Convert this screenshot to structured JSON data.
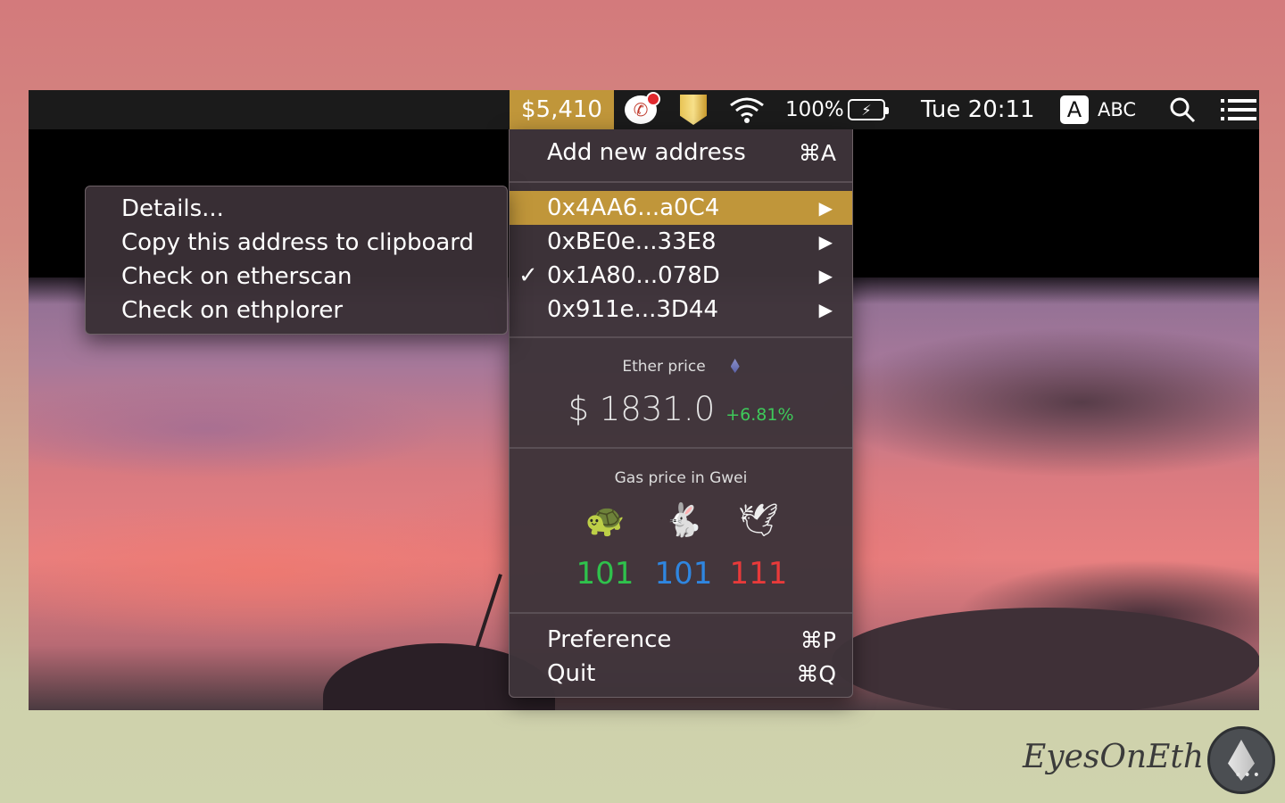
{
  "menubar": {
    "portfolio_value": "$5,410",
    "battery_percent": "100%",
    "clock": "Tue 20:11",
    "input_source_letter": "A",
    "input_source_label": "ABC",
    "icons": [
      "phone-icon",
      "shield-icon",
      "wifi-icon",
      "battery-charging-icon",
      "search-icon",
      "list-icon"
    ]
  },
  "menu": {
    "add_address": {
      "label": "Add new address",
      "shortcut": "⌘A"
    },
    "addresses": [
      {
        "label": "0x4AA6...a0C4",
        "highlighted": true,
        "checked": false,
        "arrow": "▶"
      },
      {
        "label": "0xBE0e...33E8",
        "highlighted": false,
        "checked": false,
        "arrow": "▶"
      },
      {
        "label": "0x1A80...078D",
        "highlighted": false,
        "checked": true,
        "arrow": "▶"
      },
      {
        "label": "0x911e...3D44",
        "highlighted": false,
        "checked": false,
        "arrow": "▶"
      }
    ],
    "check_mark": "✓",
    "ether": {
      "title": "Ether price",
      "value": "$ 1831.0",
      "change": "+6.81%"
    },
    "gas": {
      "title": "Gas price in Gwei",
      "tiers": [
        {
          "icon": "turtle-icon",
          "glyph": "🐢",
          "value": "101",
          "color": "#2fc24c"
        },
        {
          "icon": "rabbit-icon",
          "glyph": "🐇",
          "value": "101",
          "color": "#2f86e0"
        },
        {
          "icon": "dove-icon",
          "glyph": "🕊",
          "value": "111",
          "color": "#e83a3a"
        }
      ]
    },
    "preference": {
      "label": "Preference",
      "shortcut": "⌘P"
    },
    "quit": {
      "label": "Quit",
      "shortcut": "⌘Q"
    }
  },
  "submenu": {
    "items": [
      "Details...",
      "Copy this address to clipboard",
      "Check on etherscan",
      "Check on ethplorer"
    ]
  },
  "brand": {
    "name": "EyesOnEth"
  },
  "colors": {
    "accent": "#c0963a",
    "menu_bg": "#3e343a",
    "positive": "#3ec95a"
  }
}
